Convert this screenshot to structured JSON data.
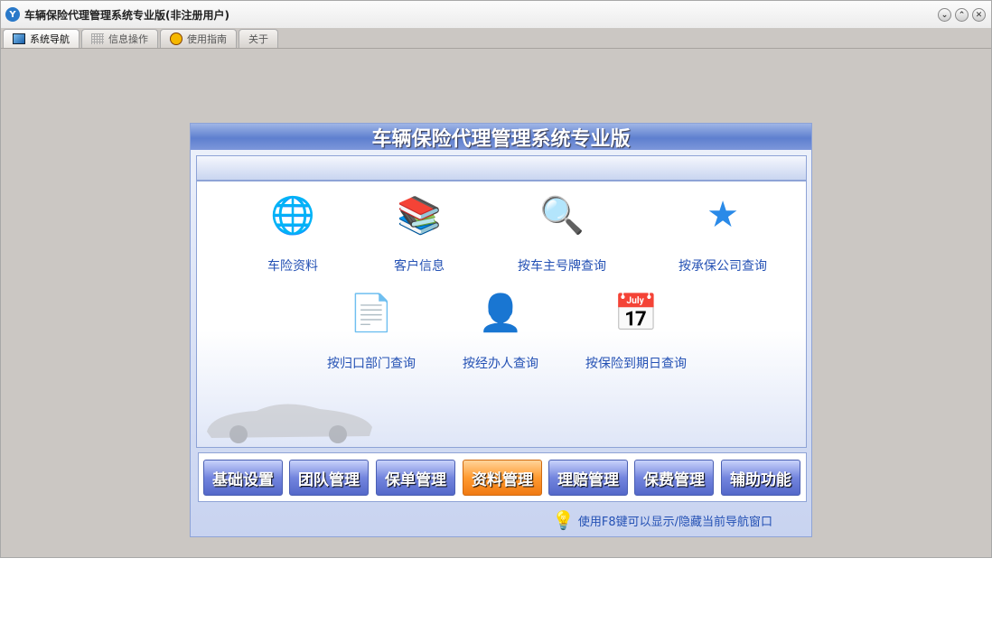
{
  "window": {
    "title": "车辆保险代理管理系统专业版(非注册用户)"
  },
  "tabs": [
    {
      "label": "系统导航"
    },
    {
      "label": "信息操作"
    },
    {
      "label": "使用指南"
    },
    {
      "label": "关于"
    }
  ],
  "panel": {
    "title": "车辆保险代理管理系统专业版",
    "items": [
      {
        "label": "车险资料",
        "icon": "globe-car-icon"
      },
      {
        "label": "客户信息",
        "icon": "books-box-icon"
      },
      {
        "label": "按车主号牌查询",
        "icon": "magnifier-icon"
      },
      {
        "label": "按承保公司查询",
        "icon": "star-icon"
      },
      {
        "label": "按归口部门查询",
        "icon": "document-search-icon"
      },
      {
        "label": "按经办人查询",
        "icon": "person-icon"
      },
      {
        "label": "按保险到期日查询",
        "icon": "calendar-icon"
      }
    ],
    "buttons": [
      {
        "label": "基础设置"
      },
      {
        "label": "团队管理"
      },
      {
        "label": "保单管理"
      },
      {
        "label": "资料管理"
      },
      {
        "label": "理赔管理"
      },
      {
        "label": "保费管理"
      },
      {
        "label": "辅助功能"
      }
    ],
    "tip": "使用F8键可以显示/隐藏当前导航窗口"
  }
}
